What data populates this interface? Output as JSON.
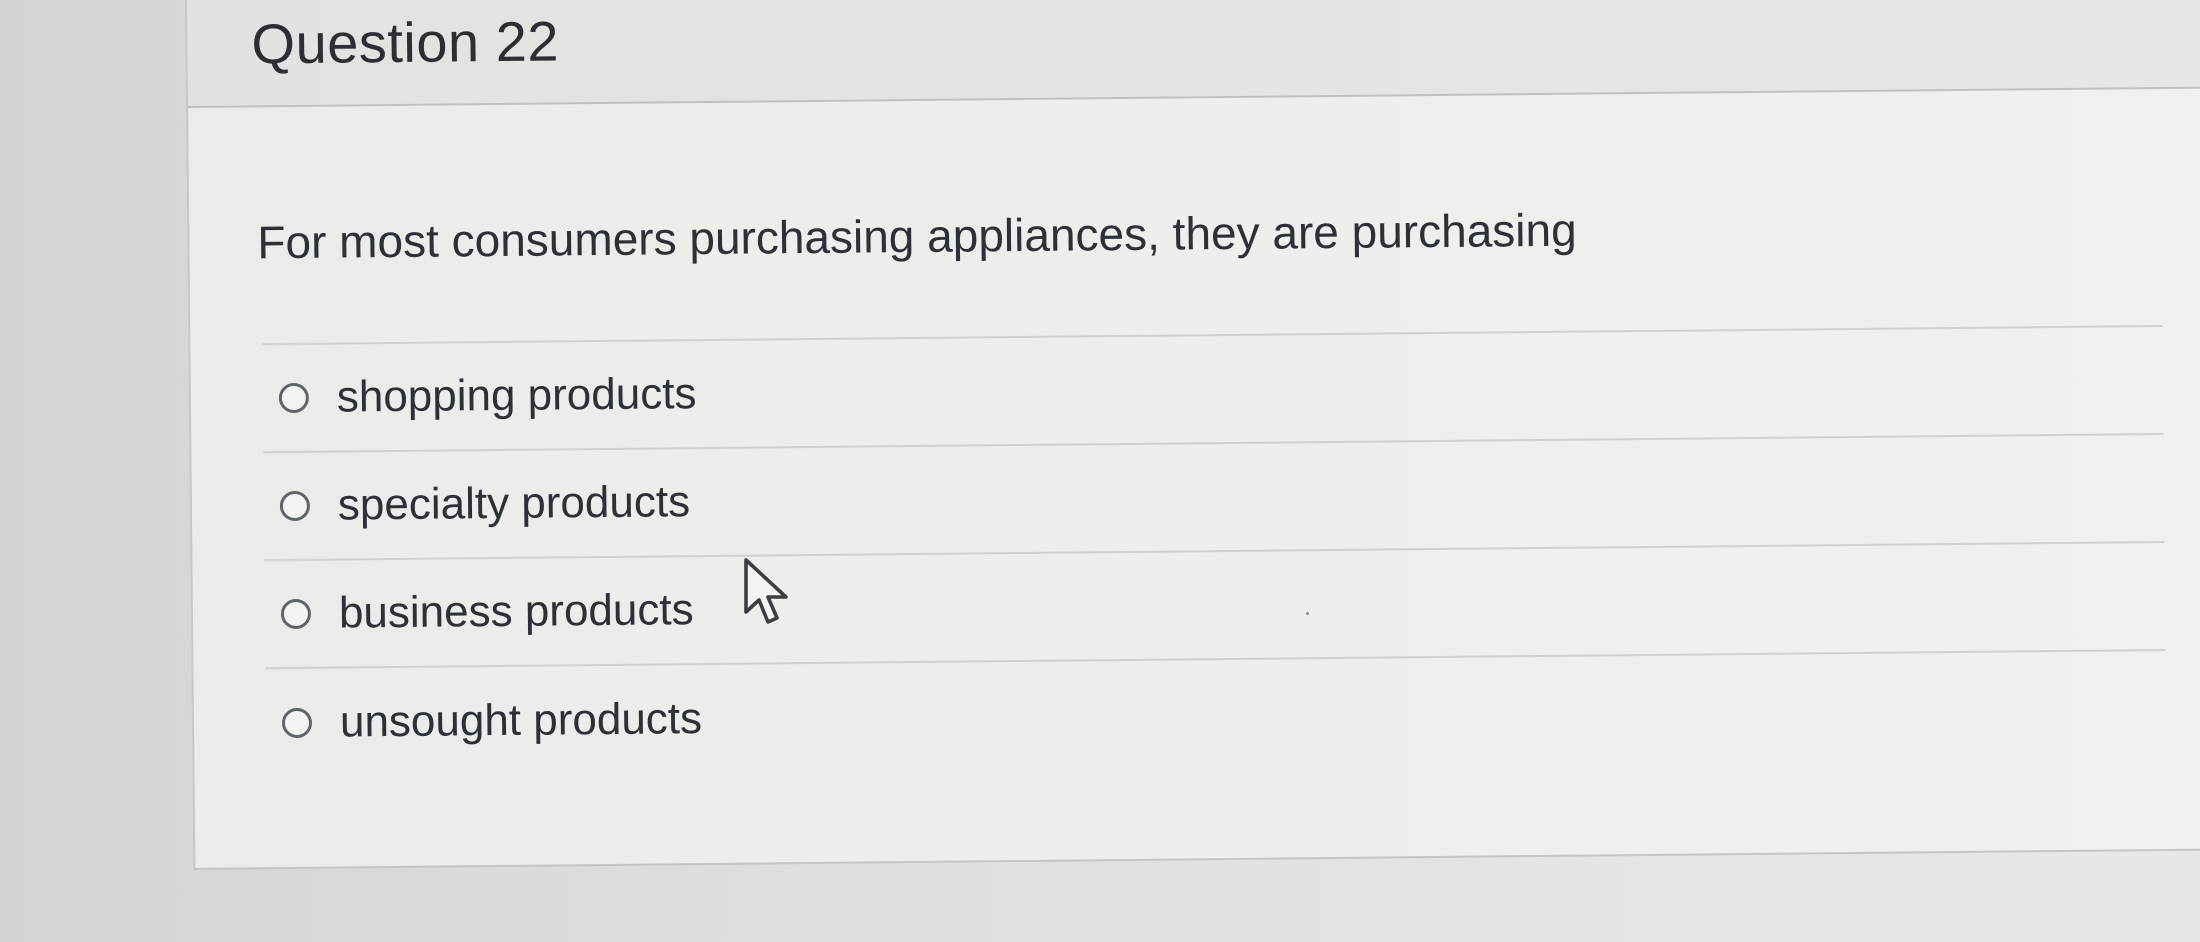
{
  "question": {
    "title": "Question 22",
    "text": "For most consumers purchasing appliances, they are purchasing",
    "answers": [
      {
        "label": "shopping products",
        "selected": false
      },
      {
        "label": "specialty products",
        "selected": false
      },
      {
        "label": "business products",
        "selected": false
      },
      {
        "label": "unsought products",
        "selected": false
      }
    ]
  },
  "icons": {
    "radio": "radio-unselected-icon",
    "cursor": "mouse-pointer-icon"
  },
  "colors": {
    "page_background": "#d9dbd8",
    "card_background": "#edefec",
    "text": "#2b3137",
    "divider": "#cfd1ce",
    "radio_border": "#5e6569"
  }
}
